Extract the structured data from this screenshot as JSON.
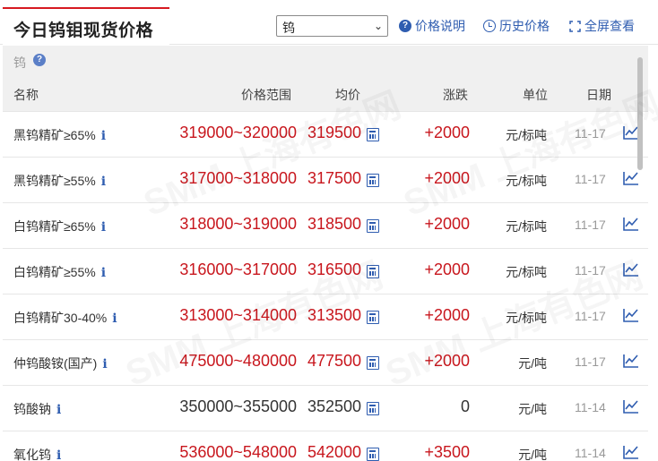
{
  "header": {
    "title": "今日钨钼现货价格",
    "select_value": "钨",
    "links": [
      {
        "icon": "question-icon",
        "label": "价格说明"
      },
      {
        "icon": "clock-icon",
        "label": "历史价格"
      },
      {
        "icon": "fullscreen-icon",
        "label": "全屏查看"
      }
    ]
  },
  "section": {
    "label": "钨"
  },
  "columns": {
    "name": "名称",
    "range": "价格范围",
    "avg": "均价",
    "change": "涨跌",
    "unit": "单位",
    "date": "日期"
  },
  "rows": [
    {
      "name": "黑钨精矿≥65%",
      "range": "319000~320000",
      "avg": "319500",
      "change": "+2000",
      "unit": "元/标吨",
      "date": "11-17"
    },
    {
      "name": "黑钨精矿≥55%",
      "range": "317000~318000",
      "avg": "317500",
      "change": "+2000",
      "unit": "元/标吨",
      "date": "11-17"
    },
    {
      "name": "白钨精矿≥65%",
      "range": "318000~319000",
      "avg": "318500",
      "change": "+2000",
      "unit": "元/标吨",
      "date": "11-17"
    },
    {
      "name": "白钨精矿≥55%",
      "range": "316000~317000",
      "avg": "316500",
      "change": "+2000",
      "unit": "元/标吨",
      "date": "11-17"
    },
    {
      "name": "白钨精矿30-40%",
      "range": "313000~314000",
      "avg": "313500",
      "change": "+2000",
      "unit": "元/标吨",
      "date": "11-17"
    },
    {
      "name": "仲钨酸铵(国产)",
      "range": "475000~480000",
      "avg": "477500",
      "change": "+2000",
      "unit": "元/吨",
      "date": "11-17"
    },
    {
      "name": "钨酸钠",
      "range": "350000~355000",
      "avg": "352500",
      "change": "0",
      "unit": "元/吨",
      "date": "11-14"
    },
    {
      "name": "氧化钨",
      "range": "536000~548000",
      "avg": "542000",
      "change": "+3500",
      "unit": "元/吨",
      "date": "11-14"
    }
  ],
  "info_glyph": "i",
  "watermark": "SMM 上海有色网",
  "colors": {
    "accent_red": "#c8161d",
    "link_blue": "#2f5db0",
    "tab_red": "#d71920"
  }
}
